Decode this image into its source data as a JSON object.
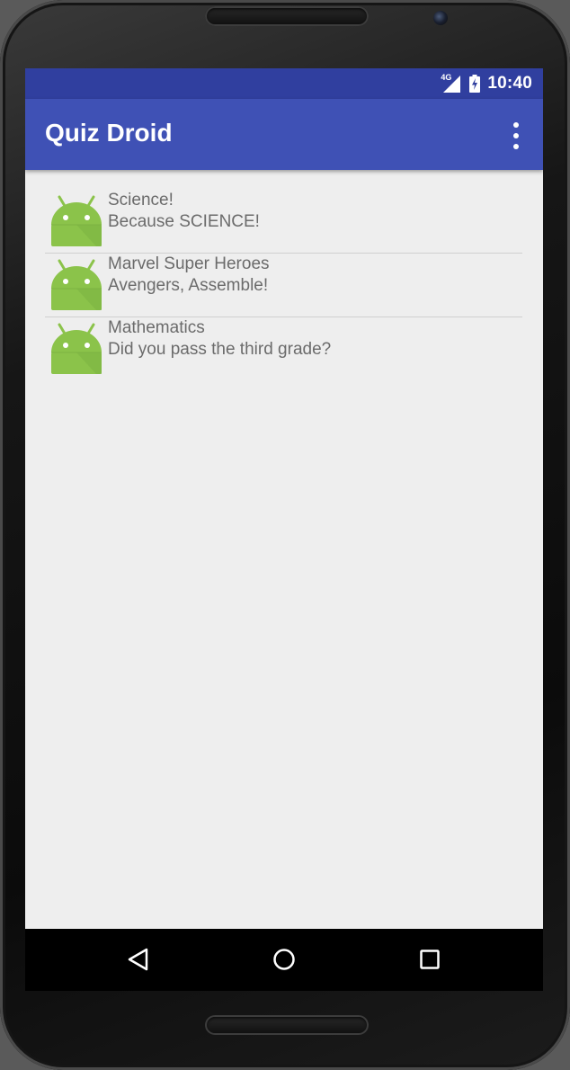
{
  "status_bar": {
    "network": "4G",
    "time": "10:40",
    "icons": [
      "signal-icon",
      "battery-charging-icon"
    ]
  },
  "app_bar": {
    "title": "Quiz Droid",
    "overflow_icon": "more-vert-icon"
  },
  "colors": {
    "primary": "#3f51b5",
    "primary_dark": "#303f9f",
    "background": "#eeeeee",
    "list_text": "#6b6b6b",
    "android_green": "#8bc34a"
  },
  "quizzes": [
    {
      "title": "Science!",
      "description": "Because SCIENCE!",
      "icon": "android-icon"
    },
    {
      "title": "Marvel Super Heroes",
      "description": "Avengers, Assemble!",
      "icon": "android-icon"
    },
    {
      "title": "Mathematics",
      "description": "Did you pass the third grade?",
      "icon": "android-icon"
    }
  ],
  "nav_bar": {
    "buttons": [
      "back-icon",
      "home-icon",
      "recents-icon"
    ]
  }
}
